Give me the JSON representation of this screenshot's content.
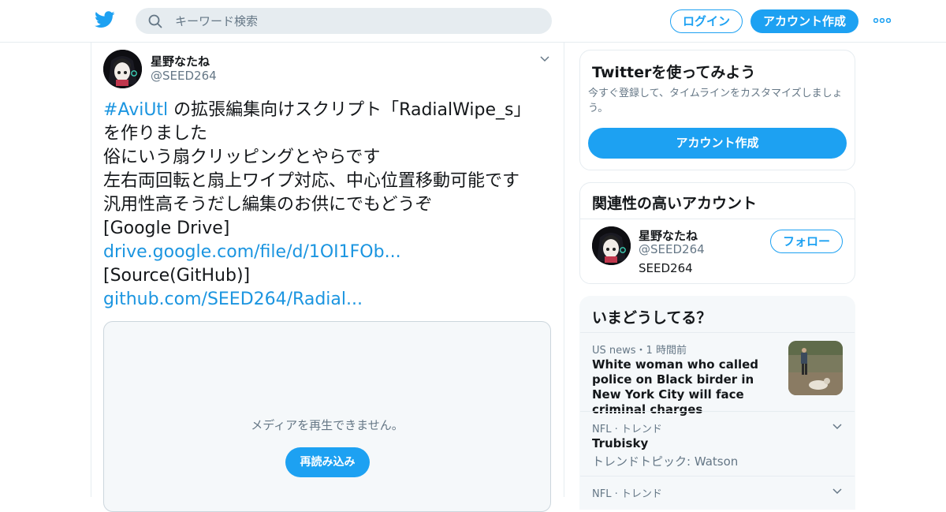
{
  "header": {
    "search_placeholder": "キーワード検索",
    "login_label": "ログイン",
    "signup_label": "アカウント作成"
  },
  "tweet": {
    "display_name": "星野なたね",
    "handle": "@SEED264",
    "hashtag": "#AviUtl",
    "line1_rest": " の拡張編集向けスクリプト「RadialWipe_s」",
    "line2": "を作りました",
    "line3": "俗にいう扇クリッピングとやらです",
    "line4": "左右両回転と扇上ワイプ対応、中心位置移動可能です",
    "line5": "汎用性高そうだし編集のお供にでもどうぞ",
    "line6": "[Google Drive]",
    "link1": "drive.google.com/file/d/1OI1FOb...",
    "line8": "[Source(GitHub)]",
    "link2": "github.com/SEED264/Radial...",
    "media_message": "メディアを再生できません。",
    "reload_label": "再読み込み"
  },
  "signup_card": {
    "title": "Twitterを使ってみよう",
    "description": "今すぐ登録して、タイムラインをカスタマイズしましょう。",
    "button_label": "アカウント作成"
  },
  "related_card": {
    "title": "関連性の高いアカウント",
    "display_name": "星野なたね",
    "handle": "@SEED264",
    "bio": "SEED264",
    "follow_label": "フォロー"
  },
  "trends_card": {
    "title": "いまどうしてる？",
    "items": [
      {
        "meta": "US news・1 時間前",
        "headline": "White woman who called police on Black birder in New York City will face criminal charges"
      },
      {
        "meta": "NFL · トレンド",
        "name": "Trubisky",
        "context": "トレンドトピック: Watson"
      },
      {
        "meta": "NFL · トレンド"
      }
    ]
  },
  "colors": {
    "accent": "#1da1f2",
    "link": "#1b95e0",
    "secondary_text": "#657786",
    "border": "#e6ecf0",
    "panel_bg": "#f5f8fa"
  }
}
